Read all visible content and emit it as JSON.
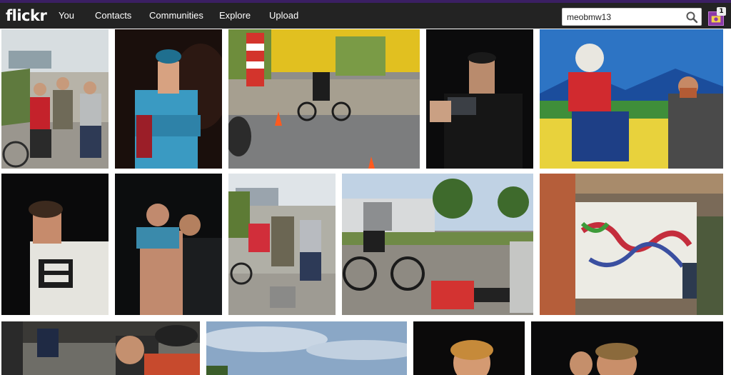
{
  "brand": {
    "logo_text": "flickr"
  },
  "nav": {
    "items": [
      {
        "label": "You"
      },
      {
        "label": "Contacts"
      },
      {
        "label": "Communities"
      },
      {
        "label": "Explore"
      },
      {
        "label": "Upload"
      }
    ]
  },
  "search": {
    "value": "meobmw13",
    "icon": "search-icon"
  },
  "notifications": {
    "count": "1",
    "icon": "notifications-icon"
  },
  "colors": {
    "nav_bg": "#101010",
    "top_strip": "#3b1f63",
    "notif_accent": "#8b3aa8"
  },
  "photo_grid": {
    "rows": [
      {
        "photos": [
          {
            "subject": "two riders embracing next to bicycles on pavement"
          },
          {
            "subject": "man in teal shirt and cap posing at night"
          },
          {
            "subject": "rider on bicycle between traffic cones, lighthouse behind"
          },
          {
            "subject": "man taking photo with camera at night"
          },
          {
            "subject": "man with sunglasses in front of a painted mural"
          }
        ]
      },
      {
        "photos": [
          {
            "subject": "man in white t-shirt at night"
          },
          {
            "subject": "two shirtless men posing at night"
          },
          {
            "subject": "group of three riders with bicycles"
          },
          {
            "subject": "cyclist riding past people sitting on ground"
          },
          {
            "subject": "painted canvas under a wooden pergola"
          }
        ]
      },
      {
        "photos": [
          {
            "subject": "people with bicycles on pavement"
          },
          {
            "subject": "sky and treetops"
          },
          {
            "subject": "man's face in dark"
          },
          {
            "subject": "two men at night"
          }
        ]
      }
    ]
  }
}
